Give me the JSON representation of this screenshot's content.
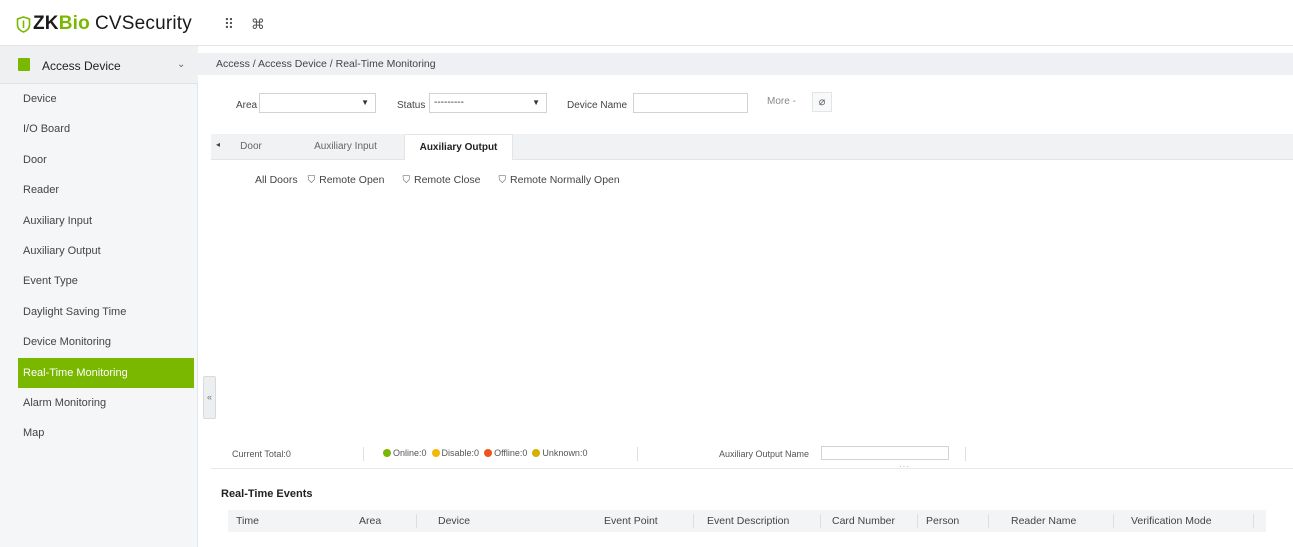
{
  "brand": {
    "zk": "ZK",
    "bio": "Bio",
    "cv": "CVSecurity"
  },
  "header": {
    "apps_icon": "grid-icon",
    "command_icon": "command-icon",
    "apps_glyph": "⠿",
    "command_glyph": "⌘"
  },
  "sidebar": {
    "module_label": "Access Device",
    "items": [
      {
        "label": "Device"
      },
      {
        "label": "I/O Board"
      },
      {
        "label": "Door"
      },
      {
        "label": "Reader"
      },
      {
        "label": "Auxiliary Input"
      },
      {
        "label": "Auxiliary Output"
      },
      {
        "label": "Event Type"
      },
      {
        "label": "Daylight Saving Time"
      },
      {
        "label": "Device Monitoring"
      },
      {
        "label": "Real-Time Monitoring",
        "active": true
      },
      {
        "label": "Alarm Monitoring"
      },
      {
        "label": "Map"
      }
    ],
    "collapse_glyph": "«"
  },
  "breadcrumb": "Access / Access Device / Real-Time Monitoring",
  "filters": {
    "area_label": "Area",
    "area_value": "",
    "status_label": "Status",
    "status_value": "---------",
    "device_name_label": "Device Name",
    "device_name_value": "",
    "more_label": "More -"
  },
  "tabs": {
    "arrow": "◂",
    "items": [
      {
        "label": "Door"
      },
      {
        "label": "Auxiliary Input"
      },
      {
        "label": "Auxiliary Output",
        "active": true
      }
    ]
  },
  "actions": {
    "all_doors": "All Doors",
    "remote_open": "Remote Open",
    "remote_close": "Remote Close",
    "remote_normally_open": "Remote Normally Open"
  },
  "status": {
    "current_total": "Current Total:0",
    "online": "Online:0",
    "disable": "Disable:0",
    "offline": "Offline:0",
    "unknown": "Unknown:0",
    "aux_output_name_label": "Auxiliary Output Name",
    "aux_output_name_value": "",
    "colors": {
      "online": "#7ab800",
      "disable": "#f5b800",
      "offline": "#f0541e",
      "unknown": "#d4b000"
    }
  },
  "events": {
    "title": "Real-Time Events",
    "columns": [
      "Time",
      "Area",
      "Device",
      "Event Point",
      "Event Description",
      "Card Number",
      "Person",
      "Reader Name",
      "Verification Mode"
    ]
  }
}
